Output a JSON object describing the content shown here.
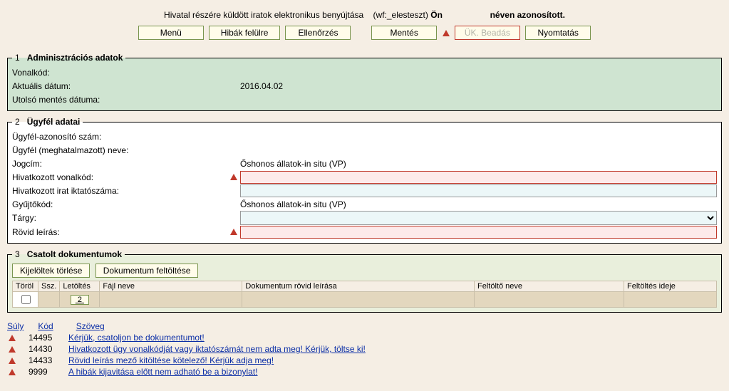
{
  "header": {
    "text_prefix": "Hivatal részére küldött iratok elektronikus benyújtása",
    "wf": "(wf:_elesteszt)",
    "on": "Ön",
    "suffix": "néven azonosított."
  },
  "toolbar": {
    "menu": "Menü",
    "errors_top": "Hibák felülre",
    "check": "Ellenőrzés",
    "save": "Mentés",
    "submit": "ÜK. Beadás",
    "print": "Nyomtatás"
  },
  "admin": {
    "legend_num": "1",
    "legend": "Adminisztrációs adatok",
    "barcode_label": "Vonalkód:",
    "barcode_value": "",
    "date_label": "Aktuális dátum:",
    "date_value": "2016.04.02",
    "lastsave_label": "Utolsó mentés dátuma:",
    "lastsave_value": ""
  },
  "client": {
    "legend_num": "2",
    "legend": "Ügyfél adatai",
    "id_label": "Ügyfél-azonosító szám:",
    "name_label": "Ügyfél (meghatalmazott) neve:",
    "jogcim_label": "Jogcím:",
    "jogcim_value": "Őshonos állatok-in situ (VP)",
    "ref_barcode_label": "Hivatkozott vonalkód:",
    "ref_barcode_value": "",
    "ref_iktato_label": "Hivatkozott irat iktatószáma:",
    "ref_iktato_value": "",
    "gyujto_label": "Gyűjtőkód:",
    "gyujto_value": "Őshonos állatok-in situ (VP)",
    "targy_label": "Tárgy:",
    "rovid_label": "Rövid leírás:",
    "rovid_value": ""
  },
  "docs": {
    "legend_num": "3",
    "legend": "Csatolt dokumentumok",
    "btn_delete": "Kijelöltek törlése",
    "btn_upload": "Dokumentum feltöltése",
    "cols": {
      "torol": "Töröl",
      "ssz": "Ssz.",
      "letoltes": "Letöltés",
      "fajl": "Fájl neve",
      "dleiras": "Dokumentum rövid leírása",
      "feltolto": "Feltöltő neve",
      "ido": "Feltöltés ideje"
    }
  },
  "errs": {
    "head_suly": "Súly",
    "head_kod": "Kód",
    "head_szoveg": "Szöveg",
    "items": [
      {
        "code": "14495",
        "text": "Kérjük, csatoljon be dokumentumot!"
      },
      {
        "code": "14430",
        "text": "Hivatkozott ügy vonalkódját vagy iktatószámát nem adta meg! Kérjük, töltse ki!"
      },
      {
        "code": "14433",
        "text": "Rövid leírás mező kitöltése kötelező! Kérjük adja meg!"
      },
      {
        "code": "9999",
        "text": "A hibák kijavitása előtt nem adható be a bizonylat!"
      }
    ]
  }
}
